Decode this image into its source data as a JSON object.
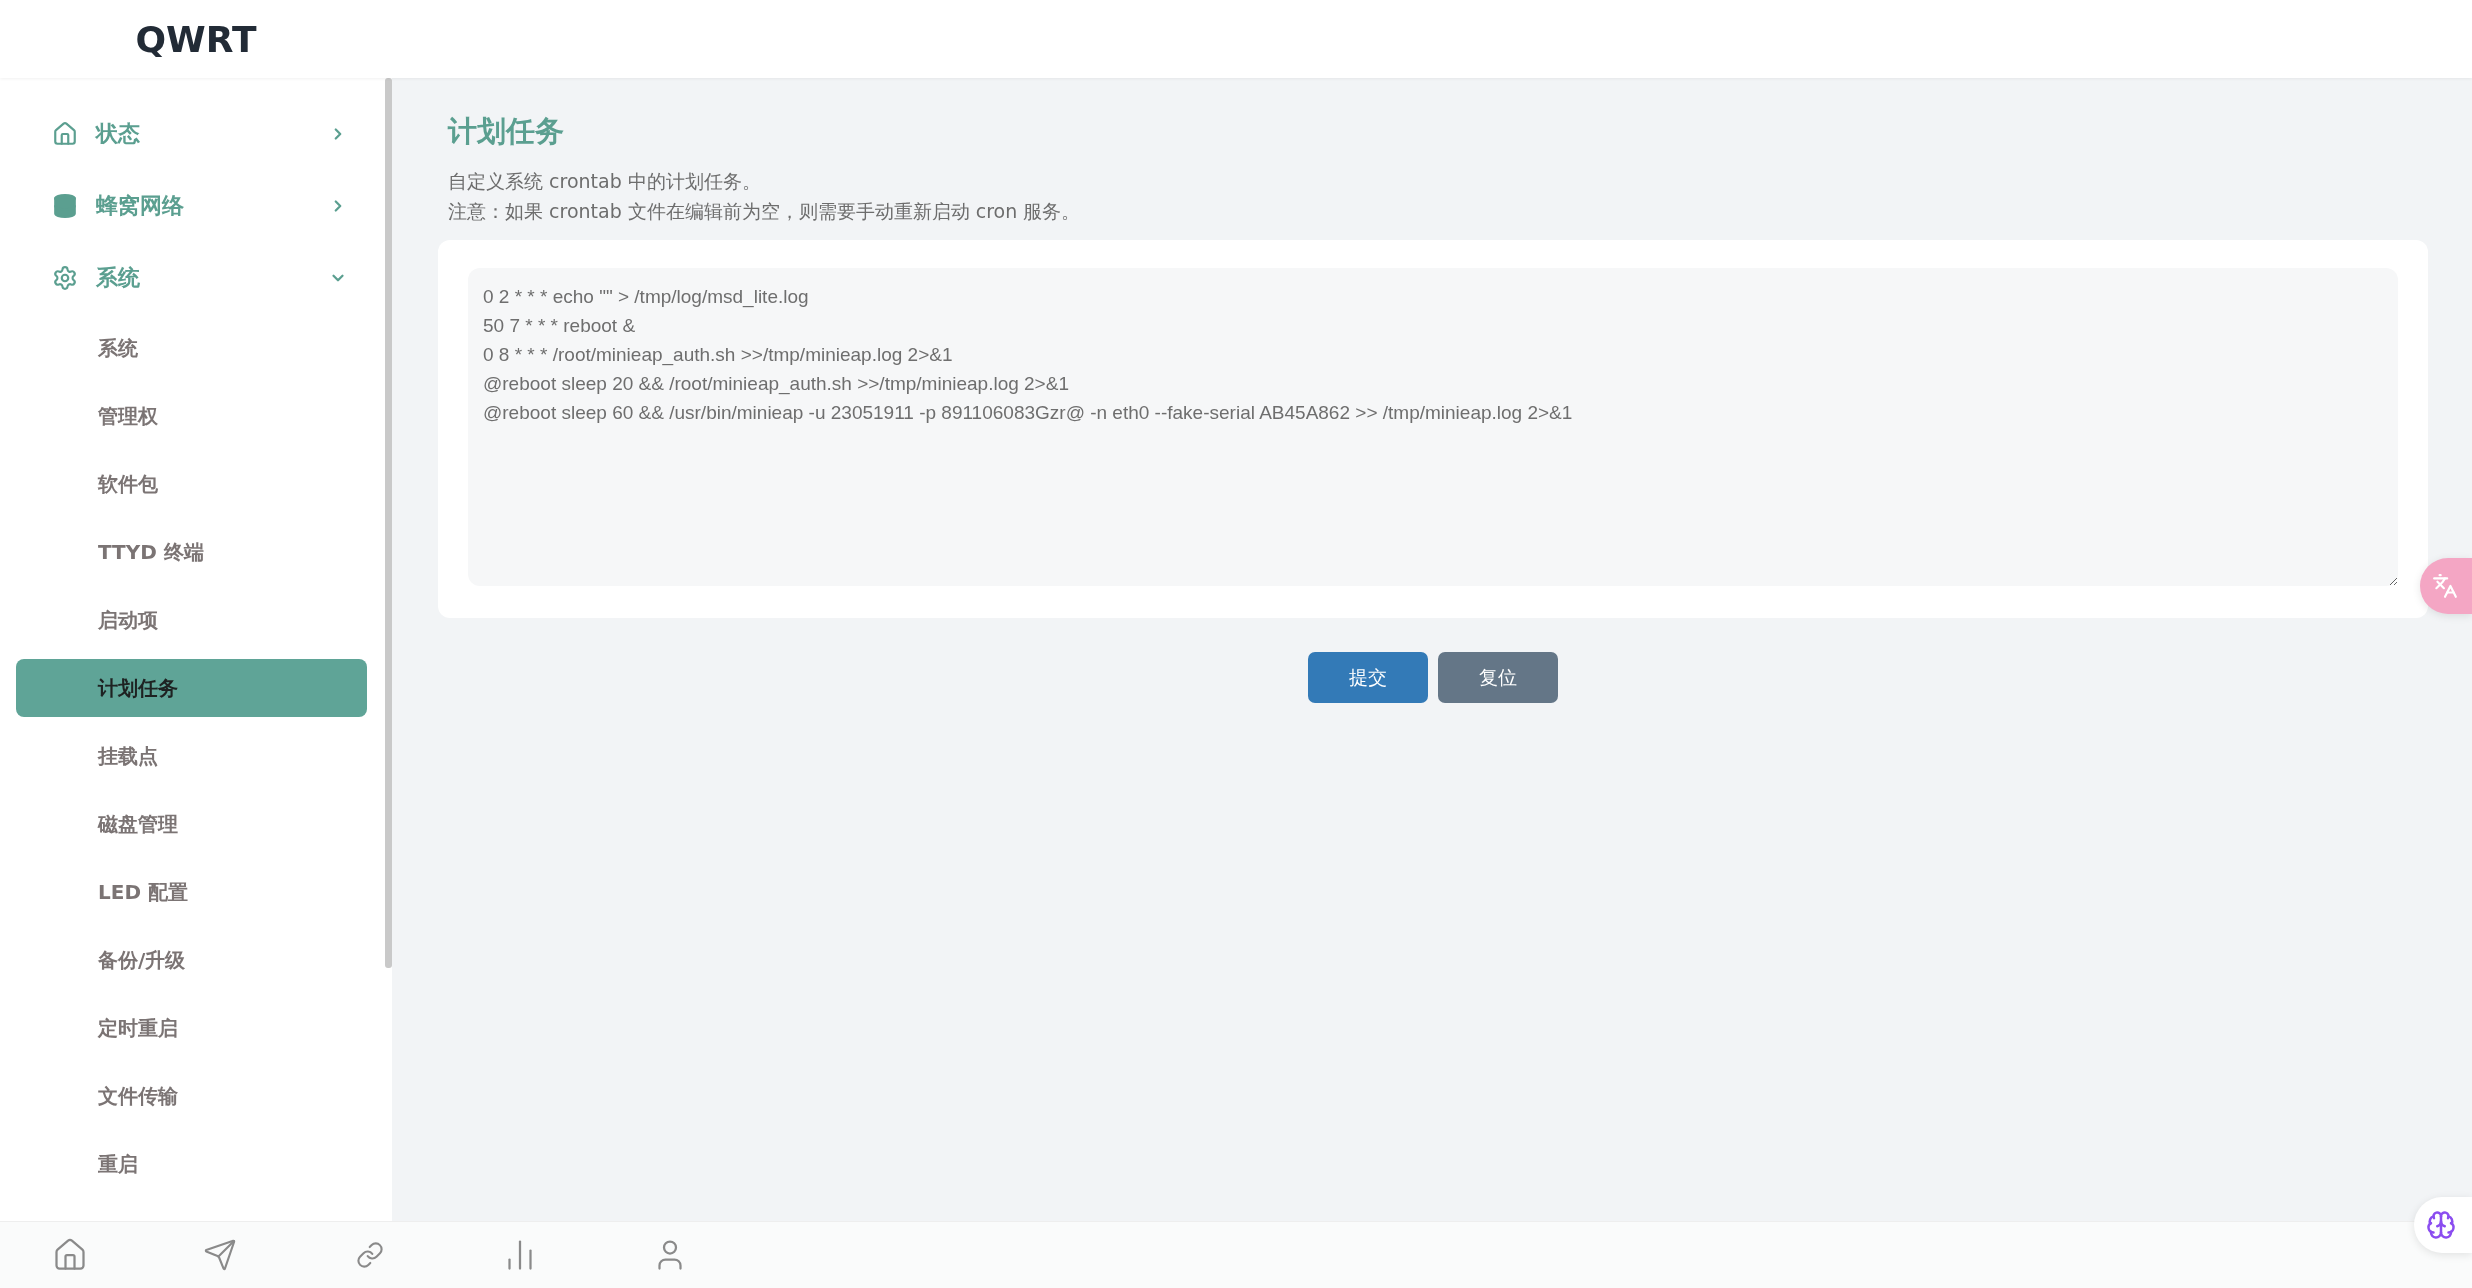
{
  "brand": "QWRT",
  "menu": [
    {
      "label": "状态",
      "expanded": false
    },
    {
      "label": "蜂窝网络",
      "expanded": false
    },
    {
      "label": "系统",
      "expanded": true,
      "children": [
        {
          "label": "系统",
          "selected": false
        },
        {
          "label": "管理权",
          "selected": false
        },
        {
          "label": "软件包",
          "selected": false
        },
        {
          "label": "TTYD 终端",
          "selected": false
        },
        {
          "label": "启动项",
          "selected": false
        },
        {
          "label": "计划任务",
          "selected": true
        },
        {
          "label": "挂载点",
          "selected": false
        },
        {
          "label": "磁盘管理",
          "selected": false
        },
        {
          "label": "LED 配置",
          "selected": false
        },
        {
          "label": "备份/升级",
          "selected": false
        },
        {
          "label": "定时重启",
          "selected": false
        },
        {
          "label": "文件传输",
          "selected": false
        },
        {
          "label": "重启",
          "selected": false
        }
      ]
    }
  ],
  "page": {
    "title": "计划任务",
    "description": [
      "自定义系统 crontab 中的计划任务。",
      "注意：如果 crontab 文件在编辑前为空，则需要手动重新启动 cron 服务。"
    ],
    "crontab_lines": [
      "0 2 * * * echo \"\" > /tmp/log/msd_lite.log",
      "50 7 * * * reboot &",
      "0 8 * * * /root/minieap_auth.sh >>/tmp/minieap.log 2>&1",
      "@reboot sleep 20 && /root/minieap_auth.sh >>/tmp/minieap.log 2>&1",
      "@reboot sleep 60 && /usr/bin/minieap -u 23051911 -p 891106083Gzr@ -n eth0 --fake-serial AB45A862 >> /tmp/minieap.log 2>&1"
    ],
    "buttons": [
      {
        "label": "提交",
        "kind": "primary"
      },
      {
        "label": "复位",
        "kind": "secondary"
      }
    ]
  }
}
